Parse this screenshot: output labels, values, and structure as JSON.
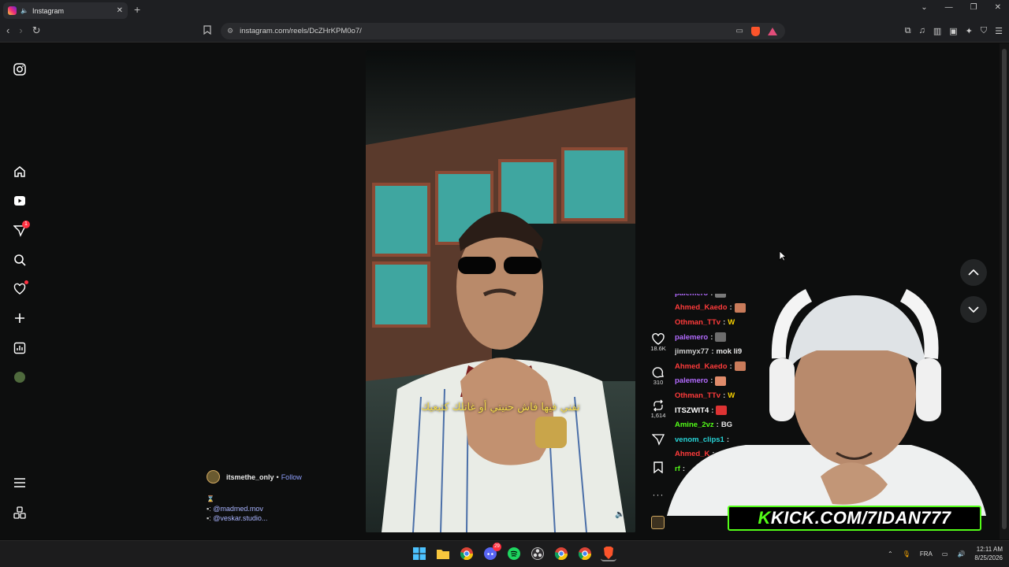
{
  "browser": {
    "tab_title": "Instagram",
    "url": "instagram.com/reels/DcZHrKPM0o7/",
    "new_tab": "+"
  },
  "sidebar": {
    "notifications_count": "1"
  },
  "reel": {
    "caption_text": "تفني فيها فاش حنيتي أو غاتلك كتبعيك",
    "likes": "18.6K",
    "comments": "310",
    "reposts": "1,614",
    "author": "itsmethe_only",
    "follow_label": "Follow",
    "separator": "•",
    "desc_line1": "⌛",
    "desc_mention1": "@madmed.mov",
    "desc_mention2": "@veskar.studio...",
    "desc_sep": ":"
  },
  "chat": {
    "messages": [
      {
        "user": "palemero",
        "color": "#b36bff",
        "text": "",
        "emote": "#7a7a7a"
      },
      {
        "user": "Ahmed_Kaedo",
        "color": "#ff3b3b",
        "text": "",
        "emote": "#c97b5a"
      },
      {
        "user": "Othman_TTv",
        "color": "#ff3b3b",
        "text": "W",
        "emote": ""
      },
      {
        "user": "palemero",
        "color": "#b36bff",
        "text": "",
        "emote": "#6d6d6d"
      },
      {
        "user": "jimmyx77",
        "color": "#d0d0d0",
        "text": "mok li9",
        "emote": ""
      },
      {
        "user": "Ahmed_Kaedo",
        "color": "#ff3b3b",
        "text": "",
        "emote": "#c97b5a"
      },
      {
        "user": "palemero",
        "color": "#b36bff",
        "text": "",
        "emote": "#e08b6a"
      },
      {
        "user": "Othman_TTv",
        "color": "#ff3b3b",
        "text": "W",
        "emote": ""
      },
      {
        "user": "ITSZWIT4",
        "color": "#ffffff",
        "text": "",
        "emote": "#d33"
      },
      {
        "user": "Amine_2vz",
        "color": "#53fc18",
        "text": "BG",
        "emote": ""
      },
      {
        "user": "venom_clips1",
        "color": "#27d3d6",
        "text": "",
        "emote": ""
      },
      {
        "user": "Ahmed_K",
        "color": "#ff3b3b",
        "text": "",
        "emote": ""
      },
      {
        "user": "rf",
        "color": "#53fc18",
        "text": "",
        "emote": ""
      }
    ]
  },
  "stream": {
    "kick_prefix": "K",
    "kick_text": "KICK.COM/7IDAN777"
  },
  "taskbar": {
    "lang": "FRA",
    "time": "12:11 AM",
    "date": "8/25/2026",
    "discord_badge": "29"
  }
}
